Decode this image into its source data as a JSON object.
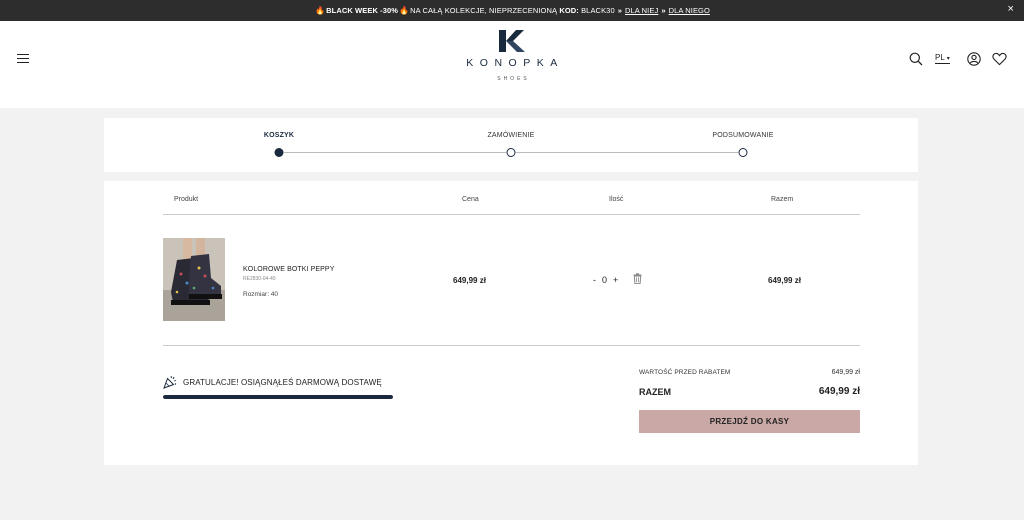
{
  "promo": {
    "fire": "🔥",
    "headline": "BLACK WEEK -30%",
    "text": "NA CAŁĄ KOLEKCJE, NIEPRZECENIONĄ",
    "code_label": "KOD:",
    "code": "BLACK30",
    "chevrons": "»",
    "link_her": "DLA NIEJ",
    "link_him": "DLA NIEGO",
    "close": "×"
  },
  "header": {
    "brand": "KONOPKA",
    "brand_sub": "SHOES",
    "lang": "PL",
    "lang_caret": "▾"
  },
  "steps": [
    {
      "label": "KOSZYK",
      "active": true
    },
    {
      "label": "ZAMÓWIENIE",
      "active": false
    },
    {
      "label": "PODSUMOWANIE",
      "active": false
    }
  ],
  "table": {
    "headers": {
      "product": "Produkt",
      "price": "Cena",
      "qty": "Ilość",
      "total": "Razem"
    }
  },
  "item": {
    "name": "KOLOROWE BOTKI PEPPY",
    "sku": "RE2830-04-40",
    "size": "Rozmiar: 40",
    "price": "649,99 zł",
    "qty_minus": "-",
    "qty": "0",
    "qty_plus": "+",
    "total": "649,99 zł"
  },
  "shipping": {
    "message": "GRATULACJE! OSIĄGNĄŁEŚ DARMOWĄ DOSTAWĘ",
    "progress": 1.0
  },
  "summary": {
    "before_discount_label": "WARTOŚĆ PRZED RABATEM",
    "before_discount_value": "649,99 zł",
    "total_label": "RAZEM",
    "total_value": "649,99 zł",
    "checkout_label": "PRZEJDŹ DO KASY"
  },
  "colors": {
    "navy": "#1a2a3e",
    "checkout": "#c9a8a5",
    "promo_bg": "#2d2d2d"
  }
}
